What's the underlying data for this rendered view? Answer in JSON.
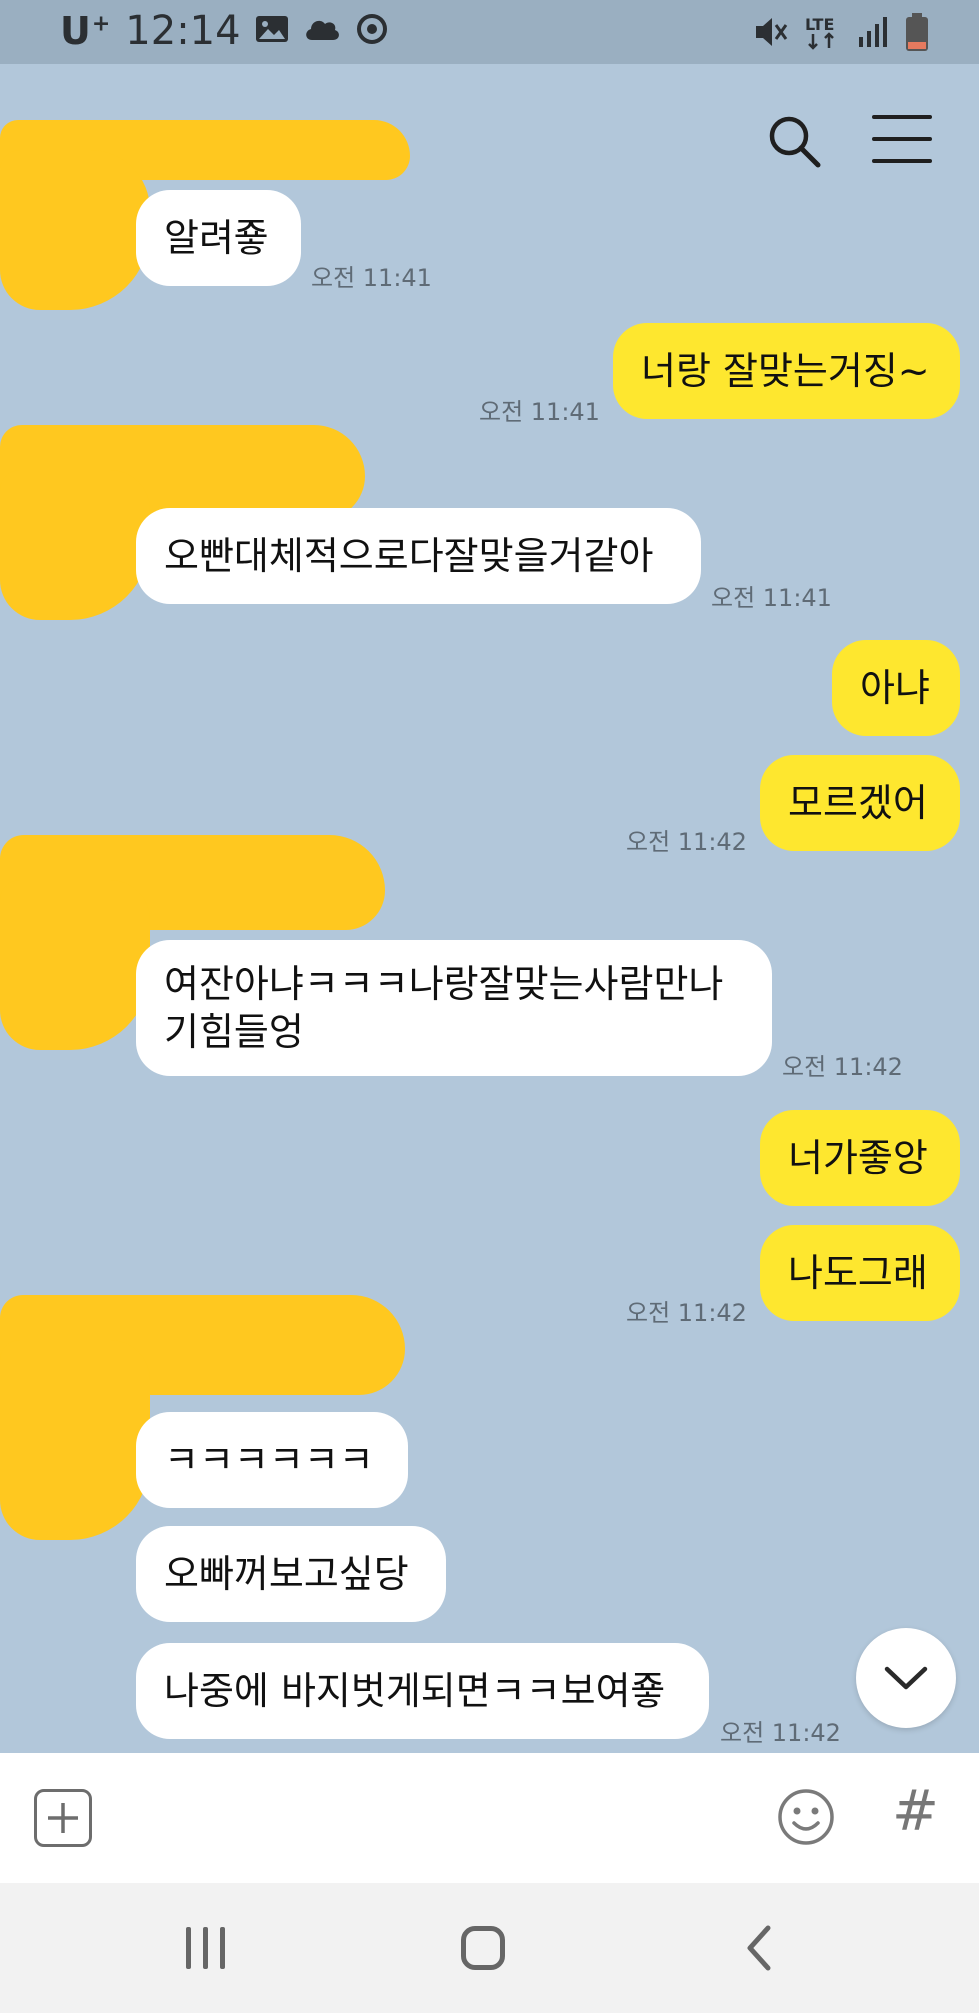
{
  "status_bar": {
    "carrier": "U",
    "carrier_plus": "+",
    "time": "12:14",
    "network": "LTE",
    "icons": [
      "gallery-icon",
      "cloud-icon",
      "sync-icon",
      "mute-icon",
      "lte-icon",
      "signal-icon",
      "battery-icon"
    ]
  },
  "colors": {
    "background": "#b2c7da",
    "sent_bubble": "#fee72f",
    "received_bubble": "#ffffff",
    "redaction": "#ffc81f"
  },
  "messages": [
    {
      "side": "received",
      "text": "알려죻",
      "time": "오전 11:41"
    },
    {
      "side": "sent",
      "text": "너랑 잘맞는거징~",
      "time": "오전 11:41"
    },
    {
      "side": "received",
      "text": "오빤대체적으로다잘맞을거같아",
      "time": "오전 11:41"
    },
    {
      "side": "sent",
      "text": "아냐",
      "time": ""
    },
    {
      "side": "sent",
      "text": "모르겠어",
      "time": "오전 11:42"
    },
    {
      "side": "received",
      "text_line1": "여잔아냐ㅋㅋㅋ나랑잘맞는사람만나",
      "text_line2": "기힘들엉",
      "time": "오전 11:42"
    },
    {
      "side": "sent",
      "text": "너가좋앙",
      "time": ""
    },
    {
      "side": "sent",
      "text": "나도그래",
      "time": "오전 11:42"
    },
    {
      "side": "received",
      "text": "ㅋㅋㅋㅋㅋㅋ",
      "time": ""
    },
    {
      "side": "received",
      "text": "오빠꺼보고싶당",
      "time": ""
    },
    {
      "side": "received",
      "text": "나중에 바지벗게되면ㅋㅋ보여죻",
      "time": "오전 11:42"
    }
  ],
  "composer": {
    "attach_icon": "plus-square-icon",
    "emoji_icon": "smiley-icon",
    "hashtag": "#"
  }
}
